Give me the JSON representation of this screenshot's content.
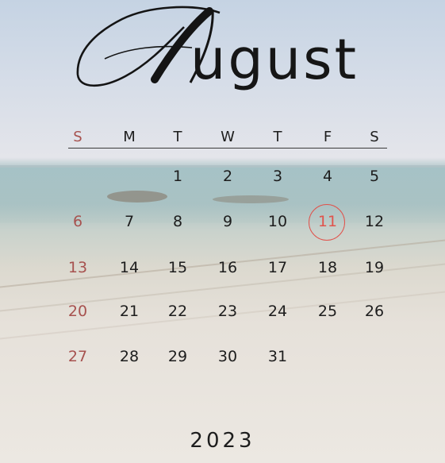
{
  "calendar": {
    "month_first_letter": "A",
    "month_rest": "ugust",
    "year": "2023",
    "weekdays": [
      "S",
      "M",
      "T",
      "W",
      "T",
      "F",
      "S"
    ],
    "weeks": [
      [
        "",
        "",
        "1",
        "2",
        "3",
        "4",
        "5"
      ],
      [
        "6",
        "7",
        "8",
        "9",
        "10",
        "11",
        "12"
      ],
      [
        "13",
        "14",
        "15",
        "16",
        "17",
        "18",
        "19"
      ],
      [
        "20",
        "21",
        "22",
        "23",
        "24",
        "25",
        "26"
      ],
      [
        "27",
        "28",
        "29",
        "30",
        "31",
        "",
        ""
      ]
    ],
    "highlighted_day": "11"
  },
  "colors": {
    "sunday": "#a7524f",
    "highlight": "#e0534c",
    "text": "#1d1d1d"
  },
  "icons": {
    "background": "beach-photo"
  }
}
